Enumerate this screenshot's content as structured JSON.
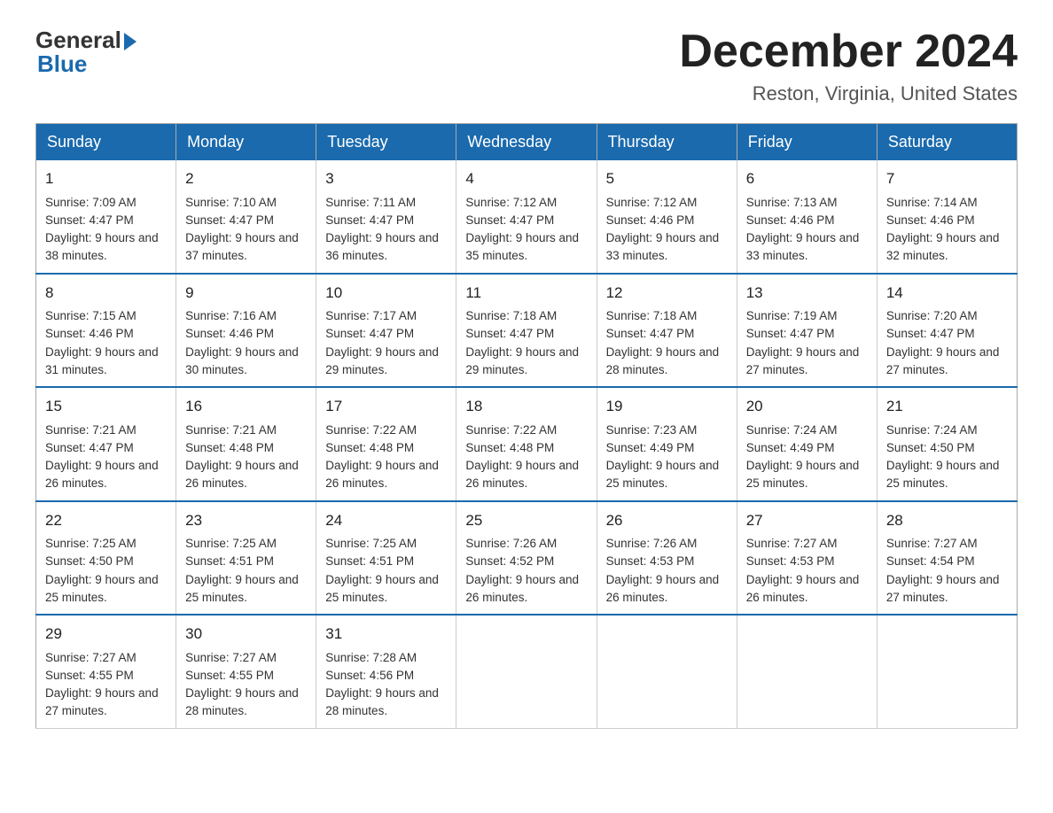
{
  "header": {
    "logo_general": "General",
    "logo_blue": "Blue",
    "month_title": "December 2024",
    "location": "Reston, Virginia, United States"
  },
  "days_of_week": [
    "Sunday",
    "Monday",
    "Tuesday",
    "Wednesday",
    "Thursday",
    "Friday",
    "Saturday"
  ],
  "weeks": [
    [
      {
        "day": "1",
        "sunrise": "7:09 AM",
        "sunset": "4:47 PM",
        "daylight": "9 hours and 38 minutes."
      },
      {
        "day": "2",
        "sunrise": "7:10 AM",
        "sunset": "4:47 PM",
        "daylight": "9 hours and 37 minutes."
      },
      {
        "day": "3",
        "sunrise": "7:11 AM",
        "sunset": "4:47 PM",
        "daylight": "9 hours and 36 minutes."
      },
      {
        "day": "4",
        "sunrise": "7:12 AM",
        "sunset": "4:47 PM",
        "daylight": "9 hours and 35 minutes."
      },
      {
        "day": "5",
        "sunrise": "7:12 AM",
        "sunset": "4:46 PM",
        "daylight": "9 hours and 33 minutes."
      },
      {
        "day": "6",
        "sunrise": "7:13 AM",
        "sunset": "4:46 PM",
        "daylight": "9 hours and 33 minutes."
      },
      {
        "day": "7",
        "sunrise": "7:14 AM",
        "sunset": "4:46 PM",
        "daylight": "9 hours and 32 minutes."
      }
    ],
    [
      {
        "day": "8",
        "sunrise": "7:15 AM",
        "sunset": "4:46 PM",
        "daylight": "9 hours and 31 minutes."
      },
      {
        "day": "9",
        "sunrise": "7:16 AM",
        "sunset": "4:46 PM",
        "daylight": "9 hours and 30 minutes."
      },
      {
        "day": "10",
        "sunrise": "7:17 AM",
        "sunset": "4:47 PM",
        "daylight": "9 hours and 29 minutes."
      },
      {
        "day": "11",
        "sunrise": "7:18 AM",
        "sunset": "4:47 PM",
        "daylight": "9 hours and 29 minutes."
      },
      {
        "day": "12",
        "sunrise": "7:18 AM",
        "sunset": "4:47 PM",
        "daylight": "9 hours and 28 minutes."
      },
      {
        "day": "13",
        "sunrise": "7:19 AM",
        "sunset": "4:47 PM",
        "daylight": "9 hours and 27 minutes."
      },
      {
        "day": "14",
        "sunrise": "7:20 AM",
        "sunset": "4:47 PM",
        "daylight": "9 hours and 27 minutes."
      }
    ],
    [
      {
        "day": "15",
        "sunrise": "7:21 AM",
        "sunset": "4:47 PM",
        "daylight": "9 hours and 26 minutes."
      },
      {
        "day": "16",
        "sunrise": "7:21 AM",
        "sunset": "4:48 PM",
        "daylight": "9 hours and 26 minutes."
      },
      {
        "day": "17",
        "sunrise": "7:22 AM",
        "sunset": "4:48 PM",
        "daylight": "9 hours and 26 minutes."
      },
      {
        "day": "18",
        "sunrise": "7:22 AM",
        "sunset": "4:48 PM",
        "daylight": "9 hours and 26 minutes."
      },
      {
        "day": "19",
        "sunrise": "7:23 AM",
        "sunset": "4:49 PM",
        "daylight": "9 hours and 25 minutes."
      },
      {
        "day": "20",
        "sunrise": "7:24 AM",
        "sunset": "4:49 PM",
        "daylight": "9 hours and 25 minutes."
      },
      {
        "day": "21",
        "sunrise": "7:24 AM",
        "sunset": "4:50 PM",
        "daylight": "9 hours and 25 minutes."
      }
    ],
    [
      {
        "day": "22",
        "sunrise": "7:25 AM",
        "sunset": "4:50 PM",
        "daylight": "9 hours and 25 minutes."
      },
      {
        "day": "23",
        "sunrise": "7:25 AM",
        "sunset": "4:51 PM",
        "daylight": "9 hours and 25 minutes."
      },
      {
        "day": "24",
        "sunrise": "7:25 AM",
        "sunset": "4:51 PM",
        "daylight": "9 hours and 25 minutes."
      },
      {
        "day": "25",
        "sunrise": "7:26 AM",
        "sunset": "4:52 PM",
        "daylight": "9 hours and 26 minutes."
      },
      {
        "day": "26",
        "sunrise": "7:26 AM",
        "sunset": "4:53 PM",
        "daylight": "9 hours and 26 minutes."
      },
      {
        "day": "27",
        "sunrise": "7:27 AM",
        "sunset": "4:53 PM",
        "daylight": "9 hours and 26 minutes."
      },
      {
        "day": "28",
        "sunrise": "7:27 AM",
        "sunset": "4:54 PM",
        "daylight": "9 hours and 27 minutes."
      }
    ],
    [
      {
        "day": "29",
        "sunrise": "7:27 AM",
        "sunset": "4:55 PM",
        "daylight": "9 hours and 27 minutes."
      },
      {
        "day": "30",
        "sunrise": "7:27 AM",
        "sunset": "4:55 PM",
        "daylight": "9 hours and 28 minutes."
      },
      {
        "day": "31",
        "sunrise": "7:28 AM",
        "sunset": "4:56 PM",
        "daylight": "9 hours and 28 minutes."
      },
      null,
      null,
      null,
      null
    ]
  ],
  "labels": {
    "sunrise": "Sunrise: ",
    "sunset": "Sunset: ",
    "daylight": "Daylight: "
  }
}
